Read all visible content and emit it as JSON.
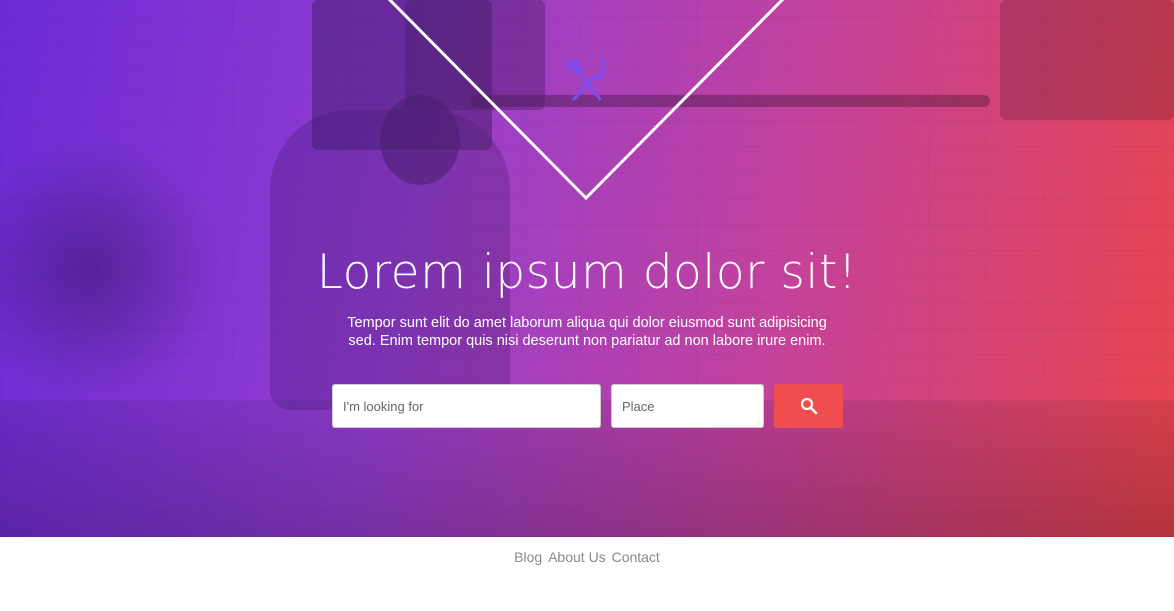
{
  "hero": {
    "title": "Lorem ipsum dolor sit!",
    "subtitle": "Tempor sunt elit do amet laborum aliqua qui dolor eiusmod sunt adipisicing sed. Enim tempor quis nisi deserunt non pariatur ad non labore irure enim.",
    "logo_icon": "fork-knife-icon",
    "gradient_colors": [
      "#6018d2",
      "#b9238c",
      "#e8343c"
    ]
  },
  "search": {
    "what_placeholder": "I'm looking for",
    "place_placeholder": "Place",
    "button_icon": "search-icon",
    "button_color": "#f04e4e"
  },
  "footer": {
    "links": [
      "Blog",
      "About Us",
      "Contact"
    ]
  }
}
